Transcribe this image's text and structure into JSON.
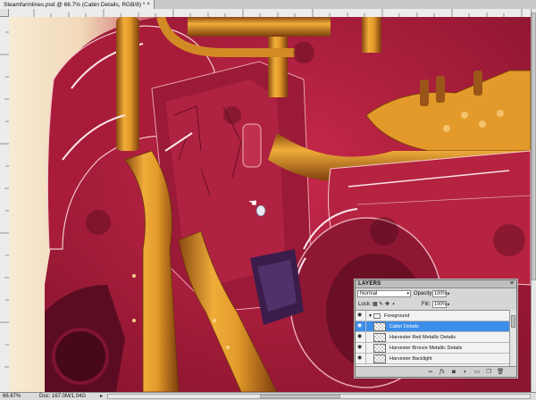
{
  "document": {
    "tab_title": "Steamfarmlines.psd @ 66.7% (Cabin Details, RGB/8) *",
    "tab_close": "×"
  },
  "ruler": {
    "top_marks": [
      "",
      "",
      "",
      "",
      "",
      ""
    ],
    "left_marks": [
      "",
      "",
      "",
      ""
    ]
  },
  "status": {
    "zoom": "66.67%",
    "doc_size": "Doc: 167.0M/1.04G",
    "arrow": "▸"
  },
  "layers_panel": {
    "title": "LAYERS",
    "menu_icon": "≡",
    "blend_mode": "Normal",
    "opacity_label": "Opacity:",
    "opacity_value": "100%",
    "lock_label": "Lock:",
    "fill_label": "Fill:",
    "fill_value": "100%",
    "layers": [
      {
        "name": "Foreground",
        "type": "group",
        "visible": true,
        "selected": false
      },
      {
        "name": "Cabin Details",
        "type": "layer",
        "visible": true,
        "selected": true
      },
      {
        "name": "Harvester Red Metallic Details",
        "type": "layer",
        "visible": true,
        "selected": false
      },
      {
        "name": "Harvester Bronze Metallic Details",
        "type": "layer",
        "visible": true,
        "selected": false
      },
      {
        "name": "Harvester Backlight",
        "type": "layer",
        "visible": true,
        "selected": false
      }
    ],
    "footer_icons": [
      "link-icon",
      "fx-icon",
      "mask-icon",
      "adjustment-icon",
      "group-icon",
      "new-layer-icon",
      "trash-icon"
    ]
  },
  "colors": {
    "selection": "#3d8ee9",
    "crimson": "#b11e3c",
    "dark_crimson": "#6a0f24",
    "bronze": "#e39a2a",
    "cream": "#f6e7cf"
  }
}
